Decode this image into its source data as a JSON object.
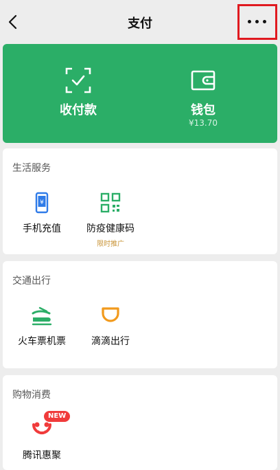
{
  "header": {
    "title": "支付",
    "back_icon": "chevron-left-icon",
    "more_icon": "more-horizontal-icon",
    "highlight_color": "#e0191f"
  },
  "hero": {
    "color": "#2bae67",
    "items": [
      {
        "label": "收付款",
        "icon": "scan-check-icon"
      },
      {
        "label": "钱包",
        "balance": "¥13.70",
        "icon": "wallet-icon"
      }
    ]
  },
  "sections": [
    {
      "title": "生活服务",
      "items": [
        {
          "label": "手机充值",
          "icon": "phone-recharge-icon"
        },
        {
          "label": "防疫健康码",
          "sub": "限时推广",
          "icon": "qr-code-icon"
        }
      ]
    },
    {
      "title": "交通出行",
      "items": [
        {
          "label": "火车票机票",
          "icon": "train-icon"
        },
        {
          "label": "滴滴出行",
          "icon": "didi-icon"
        }
      ]
    },
    {
      "title": "购物消费",
      "items": [
        {
          "label": "腾讯惠聚",
          "badge": "NEW",
          "icon": "tencent-huiju-icon"
        }
      ]
    }
  ]
}
